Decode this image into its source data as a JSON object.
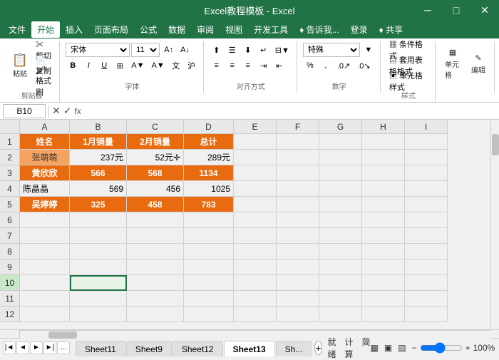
{
  "titleBar": {
    "title": "Excel教程模板 - Excel",
    "minimize": "─",
    "restore": "□",
    "close": "✕"
  },
  "menuBar": {
    "items": [
      "文件",
      "开始",
      "插入",
      "页面布局",
      "公式",
      "数据",
      "审阅",
      "视图",
      "开发工具",
      "♦ 告诉我...",
      "登录",
      "♦ 共享"
    ]
  },
  "ribbon": {
    "clipboard_label": "剪贴板",
    "font_label": "字体",
    "align_label": "对齐方式",
    "number_label": "数字",
    "styles_label": "样式",
    "cells_label": "单元格",
    "editing_label": "编辑",
    "font_name": "宋体",
    "font_size": "11",
    "number_format": "特殊",
    "conditional_format": "条件格式",
    "table_format": "套用表格格式",
    "cell_styles": "单元格样式",
    "cell_btn": "单元格",
    "edit_btn": "编辑"
  },
  "formulaBar": {
    "cellRef": "B10",
    "formula": ""
  },
  "columns": [
    "A",
    "B",
    "C",
    "D",
    "E",
    "F",
    "G",
    "H",
    "I"
  ],
  "rows": [
    1,
    2,
    3,
    4,
    5,
    6,
    7,
    8,
    9,
    10,
    11,
    12
  ],
  "tableData": {
    "headers": [
      "姓名",
      "1月销量",
      "2月销量",
      "总计"
    ],
    "rows": [
      [
        "张萌萌",
        "237元",
        "52元",
        "289元"
      ],
      [
        "黄欣欣",
        "566",
        "568",
        "1134"
      ],
      [
        "陈晶晶",
        "569",
        "456",
        "1025"
      ],
      [
        "吴婷婷",
        "325",
        "458",
        "783"
      ]
    ]
  },
  "sheets": {
    "tabs": [
      "Sheet11",
      "Sheet9",
      "Sheet12",
      "Sheet13",
      "Sh..."
    ],
    "active": "Sheet13"
  },
  "statusBar": {
    "status": "就绪",
    "calc": "计算",
    "mode": "简",
    "zoom": "100%"
  }
}
